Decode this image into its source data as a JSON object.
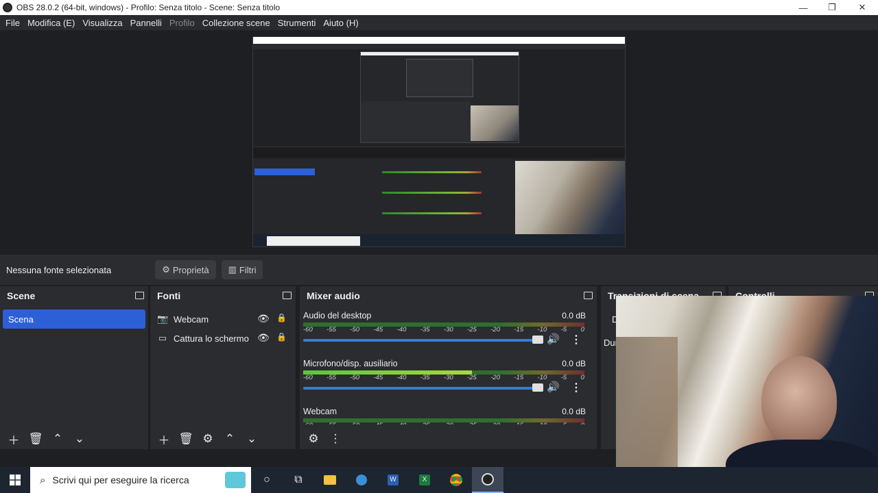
{
  "window": {
    "title": "OBS 28.0.2 (64-bit, windows) - Profilo: Senza titolo - Scene: Senza titolo",
    "minimize": "—",
    "restore": "❐",
    "close": "✕"
  },
  "menu": [
    {
      "label": "File",
      "disabled": false
    },
    {
      "label": "Modifica (E)",
      "disabled": false
    },
    {
      "label": "Visualizza",
      "disabled": false
    },
    {
      "label": "Pannelli",
      "disabled": false
    },
    {
      "label": "Profilo",
      "disabled": true
    },
    {
      "label": "Collezione scene",
      "disabled": false
    },
    {
      "label": "Strumenti",
      "disabled": false
    },
    {
      "label": "Aiuto (H)",
      "disabled": false
    }
  ],
  "source_bar": {
    "label": "Nessuna fonte selezionata",
    "properties": "Proprietà",
    "filters": "Filtri"
  },
  "scenes": {
    "title": "Scene",
    "items": [
      "Scena"
    ]
  },
  "sources": {
    "title": "Fonti",
    "items": [
      {
        "name": "Webcam",
        "icon": "camera-icon"
      },
      {
        "name": "Cattura lo schermo",
        "icon": "monitor-icon"
      }
    ]
  },
  "mixer": {
    "title": "Mixer audio",
    "ticks": [
      "-60",
      "-55",
      "-50",
      "-45",
      "-40",
      "-35",
      "-30",
      "-25",
      "-20",
      "-15",
      "-10",
      "-5",
      "0"
    ],
    "channels": [
      {
        "name": "Audio del desktop",
        "db": "0.0 dB",
        "level": 0.0,
        "volume": 1.0
      },
      {
        "name": "Microfono/disp. ausiliario",
        "db": "0.0 dB",
        "level": 0.6,
        "volume": 1.0
      },
      {
        "name": "Webcam",
        "db": "0.0 dB",
        "level": 0.0,
        "volume": 1.0
      }
    ]
  },
  "transitions": {
    "title": "Transizioni di scena",
    "row1": "D",
    "row2": "Dur"
  },
  "controls": {
    "title": "Controlli"
  },
  "taskbar": {
    "search_placeholder": "Scrivi qui per eseguire la ricerca",
    "apps": [
      "cortana-icon",
      "task-view-icon",
      "file-explorer-icon",
      "edge-icon",
      "word-icon",
      "excel-icon",
      "chrome-icon",
      "obs-icon"
    ]
  },
  "colors": {
    "accent": "#2d5fd6",
    "dock_bg": "#2b2c30",
    "app_bg": "#1e1f22"
  }
}
